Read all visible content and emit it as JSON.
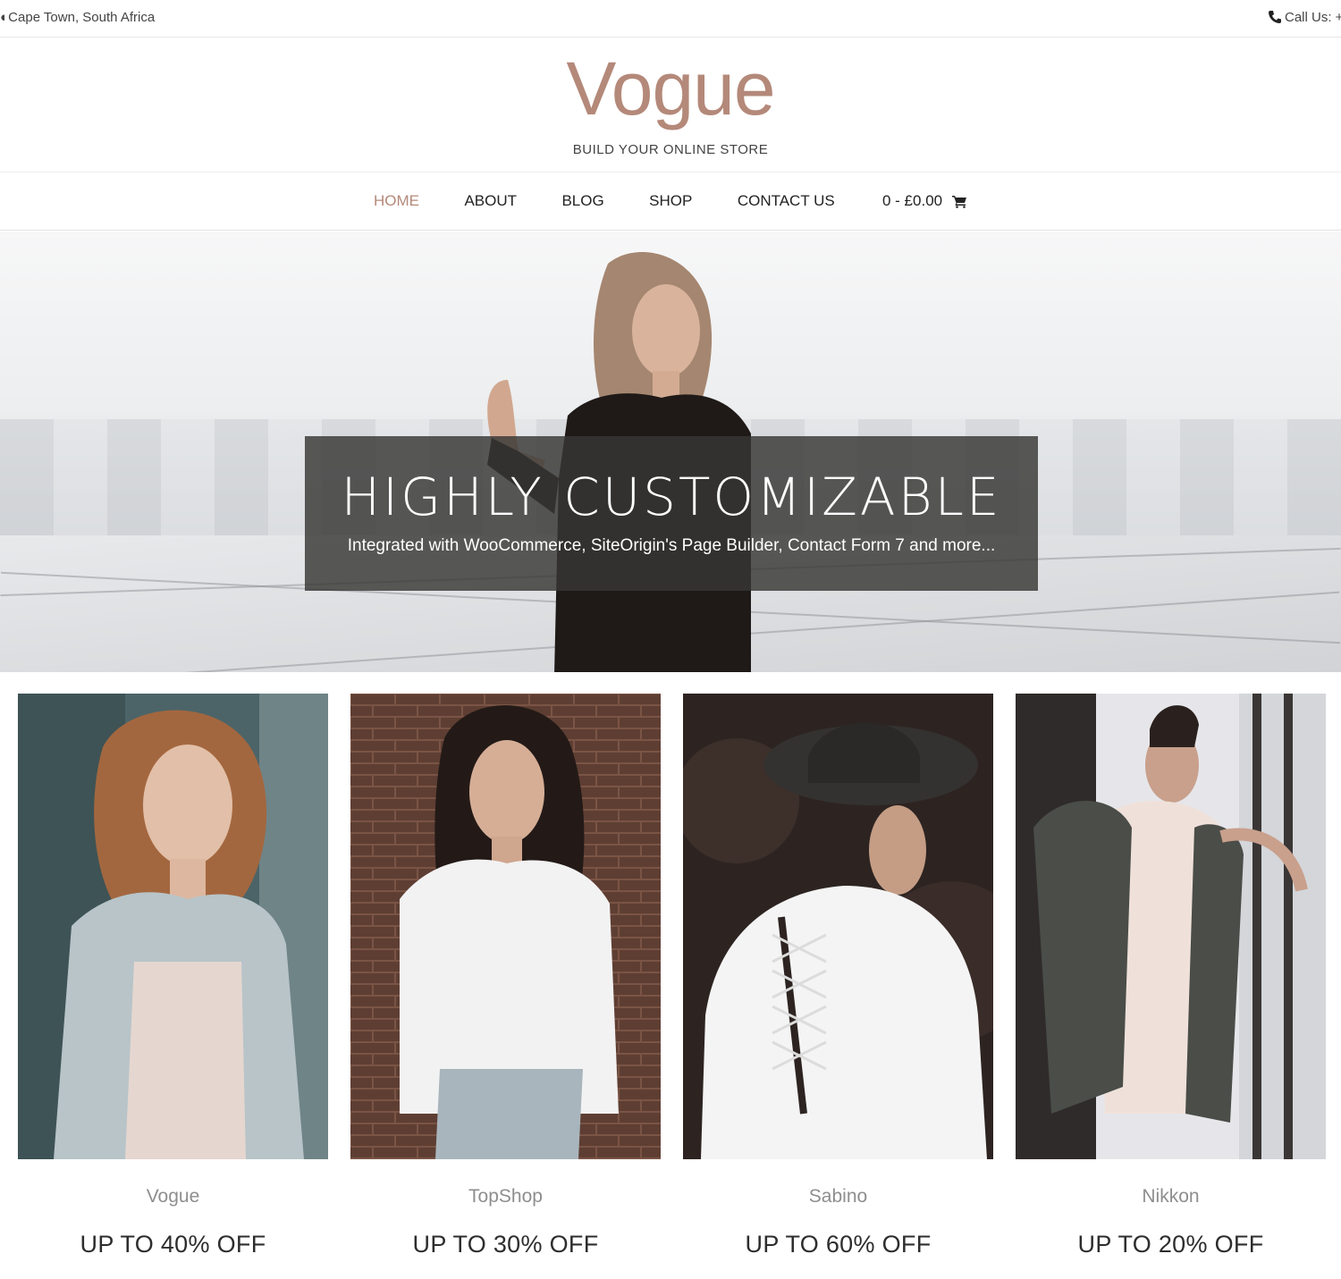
{
  "topbar": {
    "location": "Cape Town, South Africa",
    "location_icon": "map-pin-icon",
    "phone_label": "Call Us: +",
    "phone_icon": "phone-icon"
  },
  "header": {
    "logo": "Vogue",
    "tagline": "BUILD YOUR ONLINE STORE",
    "accent_color": "#b4897a"
  },
  "nav": {
    "items": [
      {
        "label": "HOME",
        "active": true
      },
      {
        "label": "ABOUT"
      },
      {
        "label": "BLOG"
      },
      {
        "label": "SHOP"
      },
      {
        "label": "CONTACT US"
      }
    ],
    "cart_label": "0 - £0.00",
    "cart_icon": "shopping-cart-icon"
  },
  "hero": {
    "title": "HIGHLY CUSTOMIZABLE",
    "subtitle": "Integrated with WooCommerce, SiteOrigin's Page Builder, Contact Form 7 and more..."
  },
  "products": [
    {
      "name": "Vogue",
      "offer": "UP TO 40% OFF"
    },
    {
      "name": "TopShop",
      "offer": "UP TO 30% OFF"
    },
    {
      "name": "Sabino",
      "offer": "UP TO 60% OFF"
    },
    {
      "name": "Nikkon",
      "offer": "UP TO 20% OFF"
    }
  ]
}
